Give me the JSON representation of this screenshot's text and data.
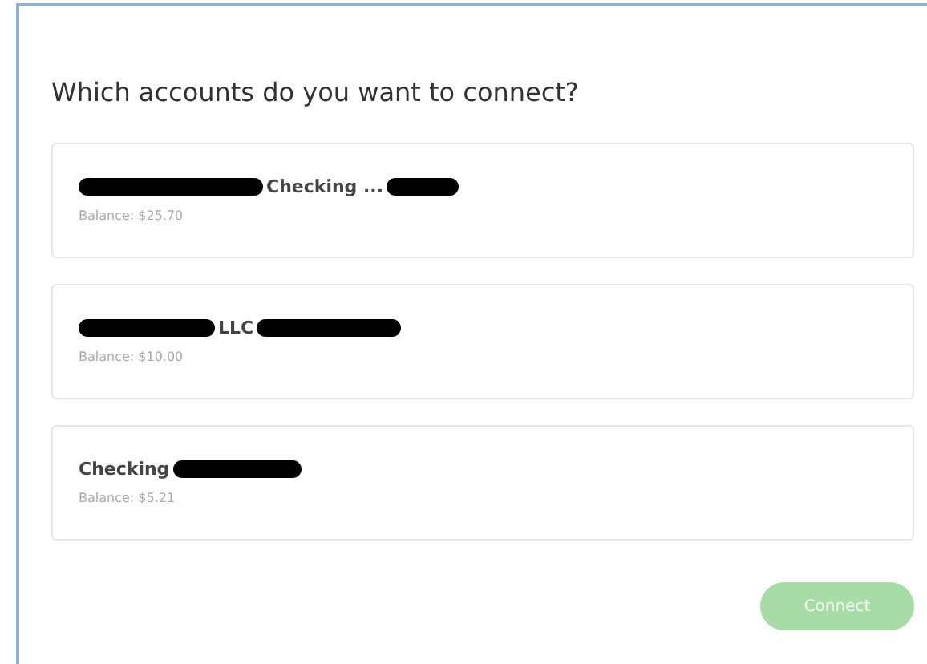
{
  "title": "Which accounts do you want to connect?",
  "accounts": [
    {
      "name": [
        {
          "kind": "redacted"
        },
        {
          "kind": "text",
          "text": "Checking ..."
        },
        {
          "kind": "redacted"
        }
      ],
      "balance": "Balance: $25.70"
    },
    {
      "name": [
        {
          "kind": "redacted"
        },
        {
          "kind": "text",
          "text": "LLC"
        },
        {
          "kind": "redacted"
        }
      ],
      "balance": "Balance: $10.00"
    },
    {
      "name": [
        {
          "kind": "text",
          "text": "Checking"
        },
        {
          "kind": "redacted"
        }
      ],
      "balance": "Balance: $5.21"
    }
  ],
  "button": {
    "label": "Connect",
    "disabled": true
  }
}
